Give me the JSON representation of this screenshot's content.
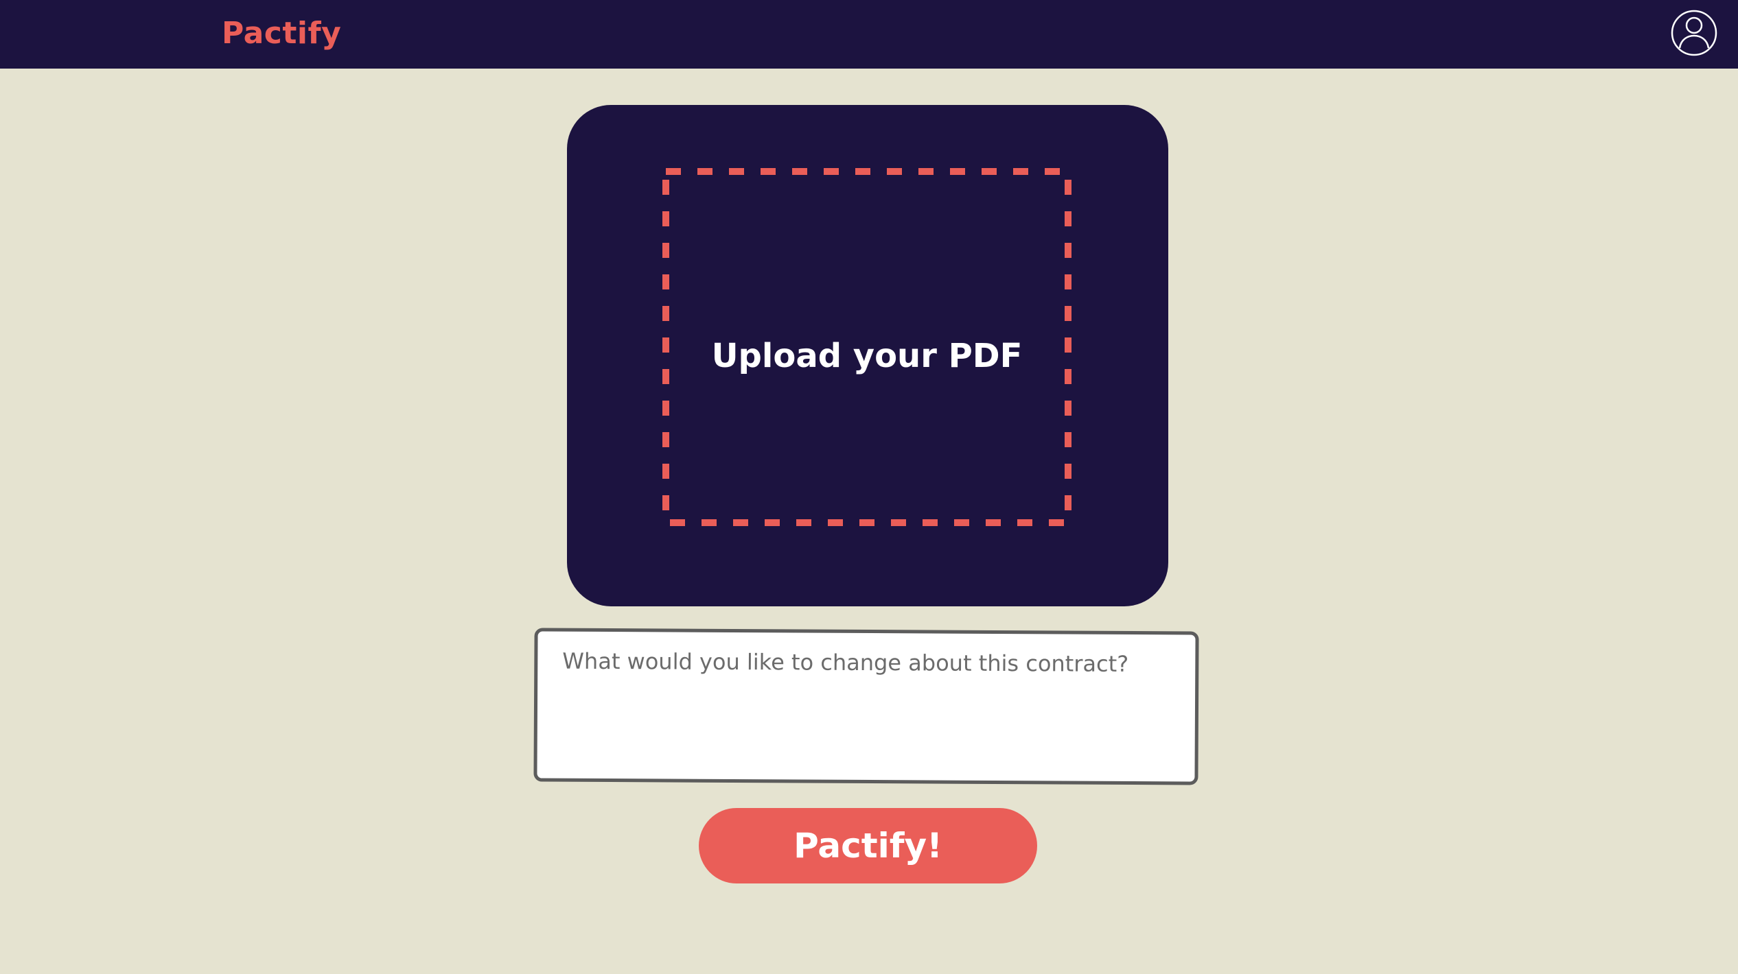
{
  "header": {
    "brand": "Pactify",
    "account_icon": "user-circle-icon"
  },
  "upload": {
    "label": "Upload your PDF",
    "dropzone_icon": "dashed-border"
  },
  "prompt": {
    "placeholder": "What would you like to change about this contract?",
    "value": ""
  },
  "actions": {
    "submit_label": "Pactify!"
  },
  "colors": {
    "navy": "#1c1340",
    "coral": "#ea5e58",
    "background": "#e5e3d0",
    "input_border": "#5c5c5c"
  }
}
